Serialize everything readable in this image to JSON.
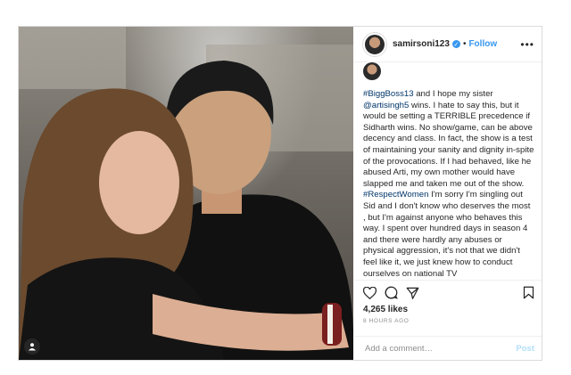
{
  "post": {
    "username": "samirsoni123",
    "follow_label": "Follow",
    "more_label": "•••",
    "caption_lines": [
      {
        "text": "#BiggBoss13",
        "link": true
      },
      {
        "text": " and I hope my sister ",
        "link": false
      },
      {
        "text": "@artisingh5",
        "link": true
      },
      {
        "text": " wins. I hate to say this, but it would be setting a TERRIBLE precedence if Sidharth wins. No show/game, can be above decency and class. In fact, the show is a test of maintaining your sanity and dignity in-spite of the provocations. If I had behaved, like he abused Arti, my own mother would have slapped me and taken me out of the show. ",
        "link": false
      },
      {
        "text": "#RespectWomen",
        "link": true
      },
      {
        "text": " I'm sorry I'm singling out Sid and I don't know who deserves the most , but I'm against anyone who behaves this way. I spent over hundred days in season 4 and there were hardly any abuses or physical aggression, it's not that we didn't feel like it, we just knew how to conduct ourselves on national TV",
        "link": false
      }
    ],
    "likes": "4,265 likes",
    "time": "8 HOURS AGO",
    "comment_placeholder": "Add a comment…",
    "post_label": "Post",
    "colors": {
      "accent": "#3897f0",
      "link": "#003569",
      "muted": "#8e8e8e"
    }
  }
}
